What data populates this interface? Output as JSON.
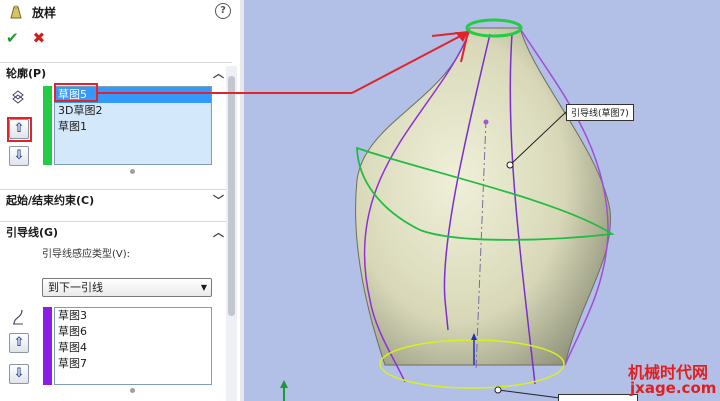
{
  "panel": {
    "title": "放样",
    "help_label": "?",
    "ok_label": "✔",
    "cancel_label": "✖",
    "profiles": {
      "header": "轮廓(P)",
      "items": [
        "草图5",
        "3D草图2",
        "草图1"
      ],
      "selected": "草图5"
    },
    "start_end": {
      "header": "起始/结束约束(C)"
    },
    "guides": {
      "header": "引导线(G)",
      "influence_label": "引导线感应类型(V):",
      "influence_value": "到下一引线",
      "items": [
        "草图3",
        "草图6",
        "草图4",
        "草图7"
      ]
    },
    "move_up": "⇧",
    "move_down": "⇩"
  },
  "viewport": {
    "callout_guide": "引导线(草图7)",
    "callout_bottom": "",
    "watermark_cn": "机械时代网",
    "watermark_en": "jxage.com"
  },
  "colors": {
    "profile_bar": "#22cc44",
    "guide_bar": "#8a1ee6",
    "highlight": "#e0242c",
    "viewport_bg": "#b2bfe6"
  }
}
